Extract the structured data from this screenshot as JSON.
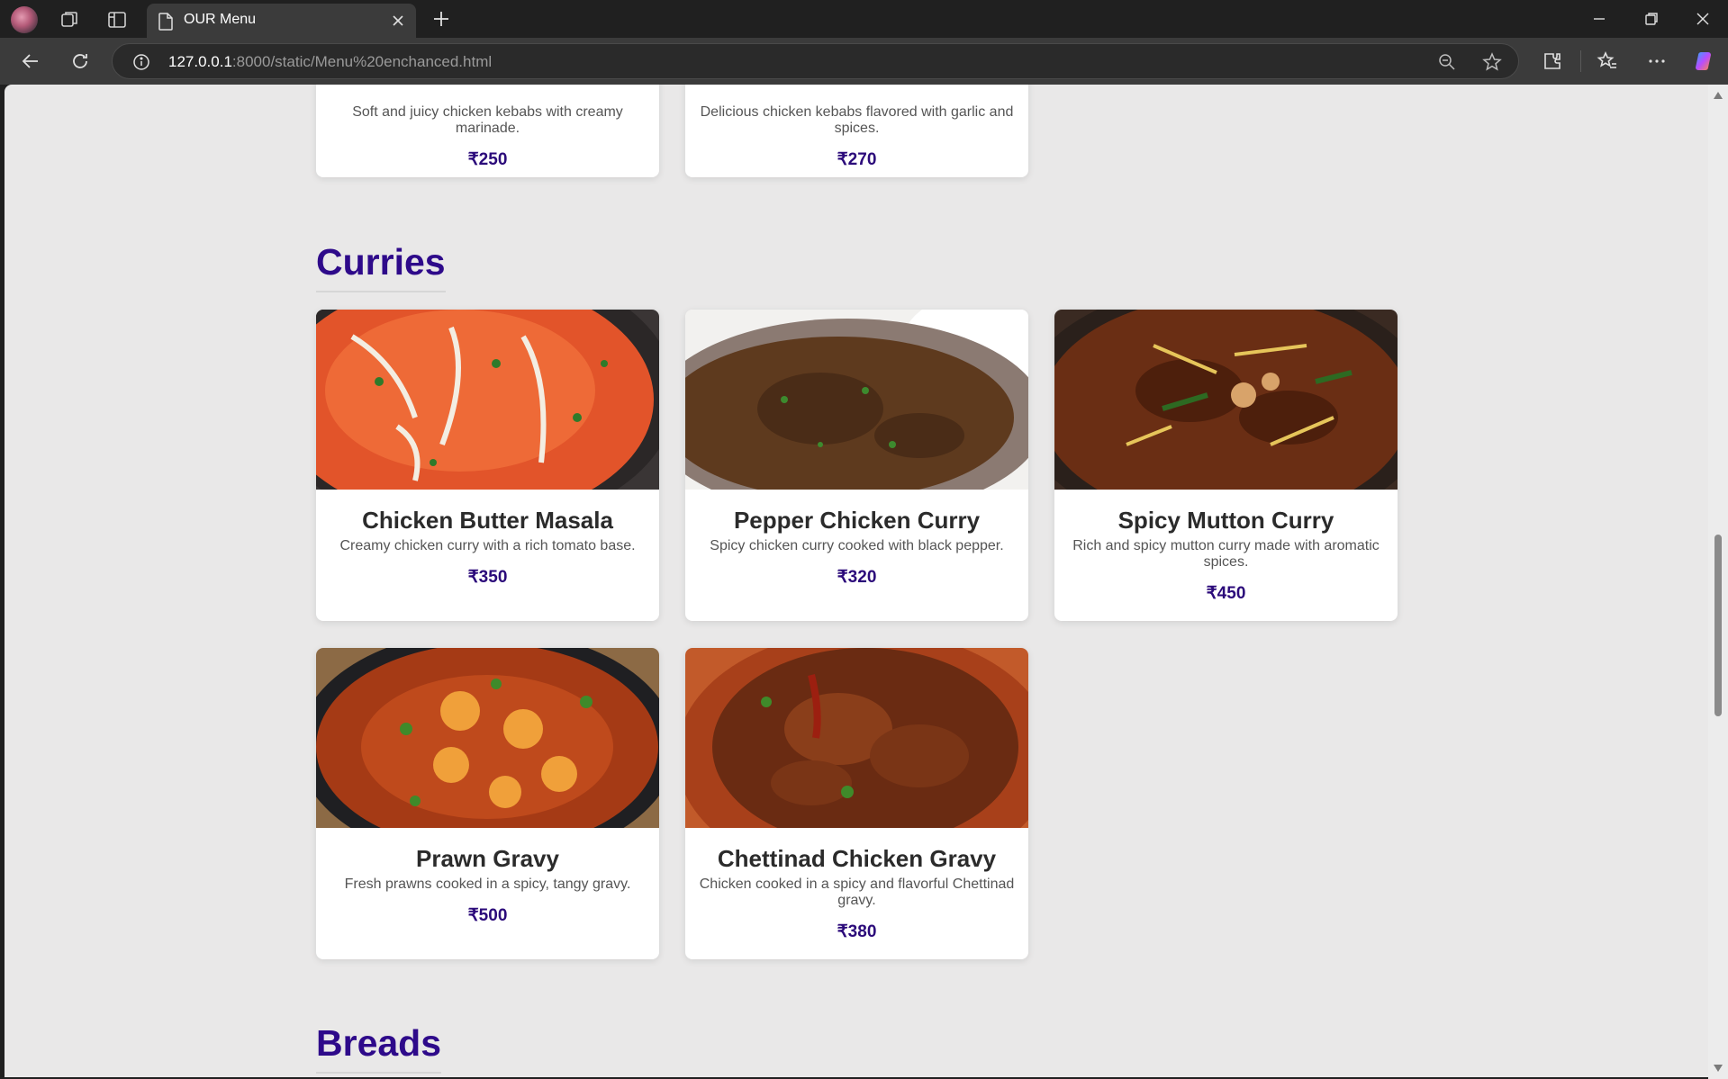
{
  "browser": {
    "tab_title": "OUR Menu",
    "url_host": "127.0.0.1",
    "url_rest": ":8000/static/Menu%20enchanced.html"
  },
  "menu": {
    "top_partial": [
      {
        "description": "Soft and juicy chicken kebabs with creamy marinade.",
        "price": "₹250"
      },
      {
        "description": "Delicious chicken kebabs flavored with garlic and spices.",
        "price": "₹270"
      }
    ],
    "curries": {
      "heading": "Curries",
      "items": [
        {
          "name": "Chicken Butter Masala",
          "description": "Creamy chicken curry with a rich tomato base.",
          "price": "₹350"
        },
        {
          "name": "Pepper Chicken Curry",
          "description": "Spicy chicken curry cooked with black pepper.",
          "price": "₹320"
        },
        {
          "name": "Spicy Mutton Curry",
          "description": "Rich and spicy mutton curry made with aromatic spices.",
          "price": "₹450"
        },
        {
          "name": "Prawn Gravy",
          "description": "Fresh prawns cooked in a spicy, tangy gravy.",
          "price": "₹500"
        },
        {
          "name": "Chettinad Chicken Gravy",
          "description": "Chicken cooked in a spicy and flavorful Chettinad gravy.",
          "price": "₹380"
        }
      ]
    },
    "breads": {
      "heading": "Breads"
    }
  }
}
